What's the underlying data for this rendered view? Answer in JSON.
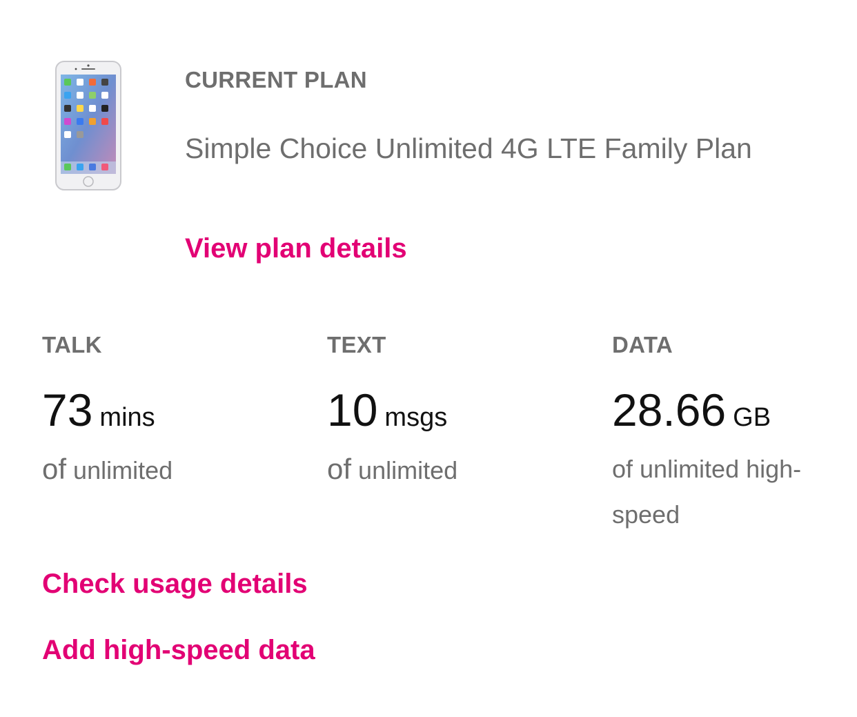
{
  "plan": {
    "section_label": "CURRENT PLAN",
    "name": "Simple Choice Unlimited 4G LTE Family Plan",
    "view_details_label": "View plan details",
    "device_image": "iphone-silver-icon"
  },
  "usage": {
    "talk": {
      "label": "TALK",
      "value": "73",
      "unit": "mins",
      "of_word": "of",
      "of_text": "unlimited"
    },
    "text": {
      "label": "TEXT",
      "value": "10",
      "unit": "msgs",
      "of_word": "of",
      "of_text": "unlimited"
    },
    "data": {
      "label": "DATA",
      "value": "28.66",
      "unit": "GB",
      "of_text": "of unlimited high-speed"
    }
  },
  "links": {
    "check_usage": "Check usage details",
    "add_data": "Add high-speed data"
  },
  "colors": {
    "accent": "#e20074",
    "label_gray": "#6e6e6e",
    "value_black": "#111111"
  }
}
